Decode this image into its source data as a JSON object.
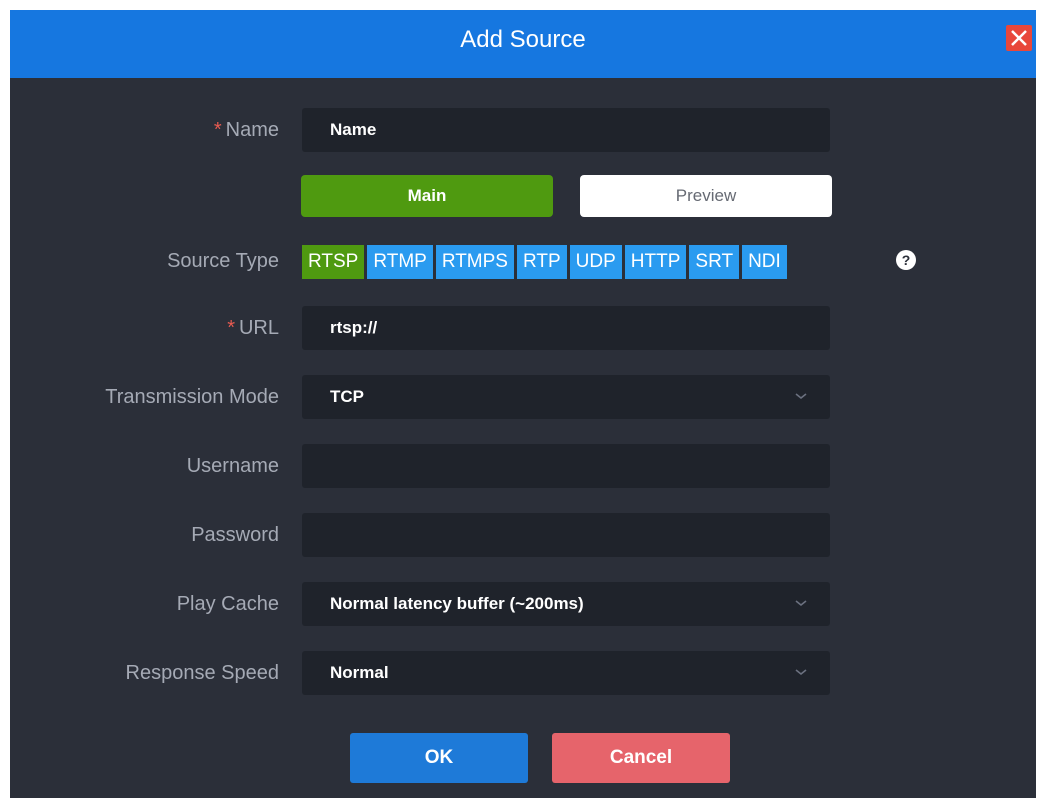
{
  "dialog": {
    "title": "Add Source",
    "close_icon": "close-icon"
  },
  "fields": {
    "name": {
      "label": "Name",
      "value": "Name",
      "required": "*"
    },
    "url": {
      "label": "URL",
      "value": "rtsp://",
      "required": "*"
    },
    "transmission_mode": {
      "label": "Transmission Mode",
      "value": "TCP"
    },
    "username": {
      "label": "Username",
      "value": ""
    },
    "password": {
      "label": "Password",
      "value": ""
    },
    "play_cache": {
      "label": "Play Cache",
      "value": "Normal latency buffer (~200ms)"
    },
    "response_speed": {
      "label": "Response Speed",
      "value": "Normal"
    }
  },
  "stream_tabs": {
    "main": "Main",
    "preview": "Preview",
    "active": "Main"
  },
  "source_type": {
    "label": "Source Type",
    "options": [
      "RTSP",
      "RTMP",
      "RTMPS",
      "RTP",
      "UDP",
      "HTTP",
      "SRT",
      "NDI"
    ],
    "active": "RTSP",
    "help_icon": "?"
  },
  "actions": {
    "ok": "OK",
    "cancel": "Cancel"
  },
  "colors": {
    "header": "#1677e0",
    "background": "#2b2f39",
    "active": "#4f9a10",
    "type_button": "#2a9bf0",
    "ok": "#1e7ad8",
    "cancel": "#e6646b",
    "close": "#e8473b"
  }
}
